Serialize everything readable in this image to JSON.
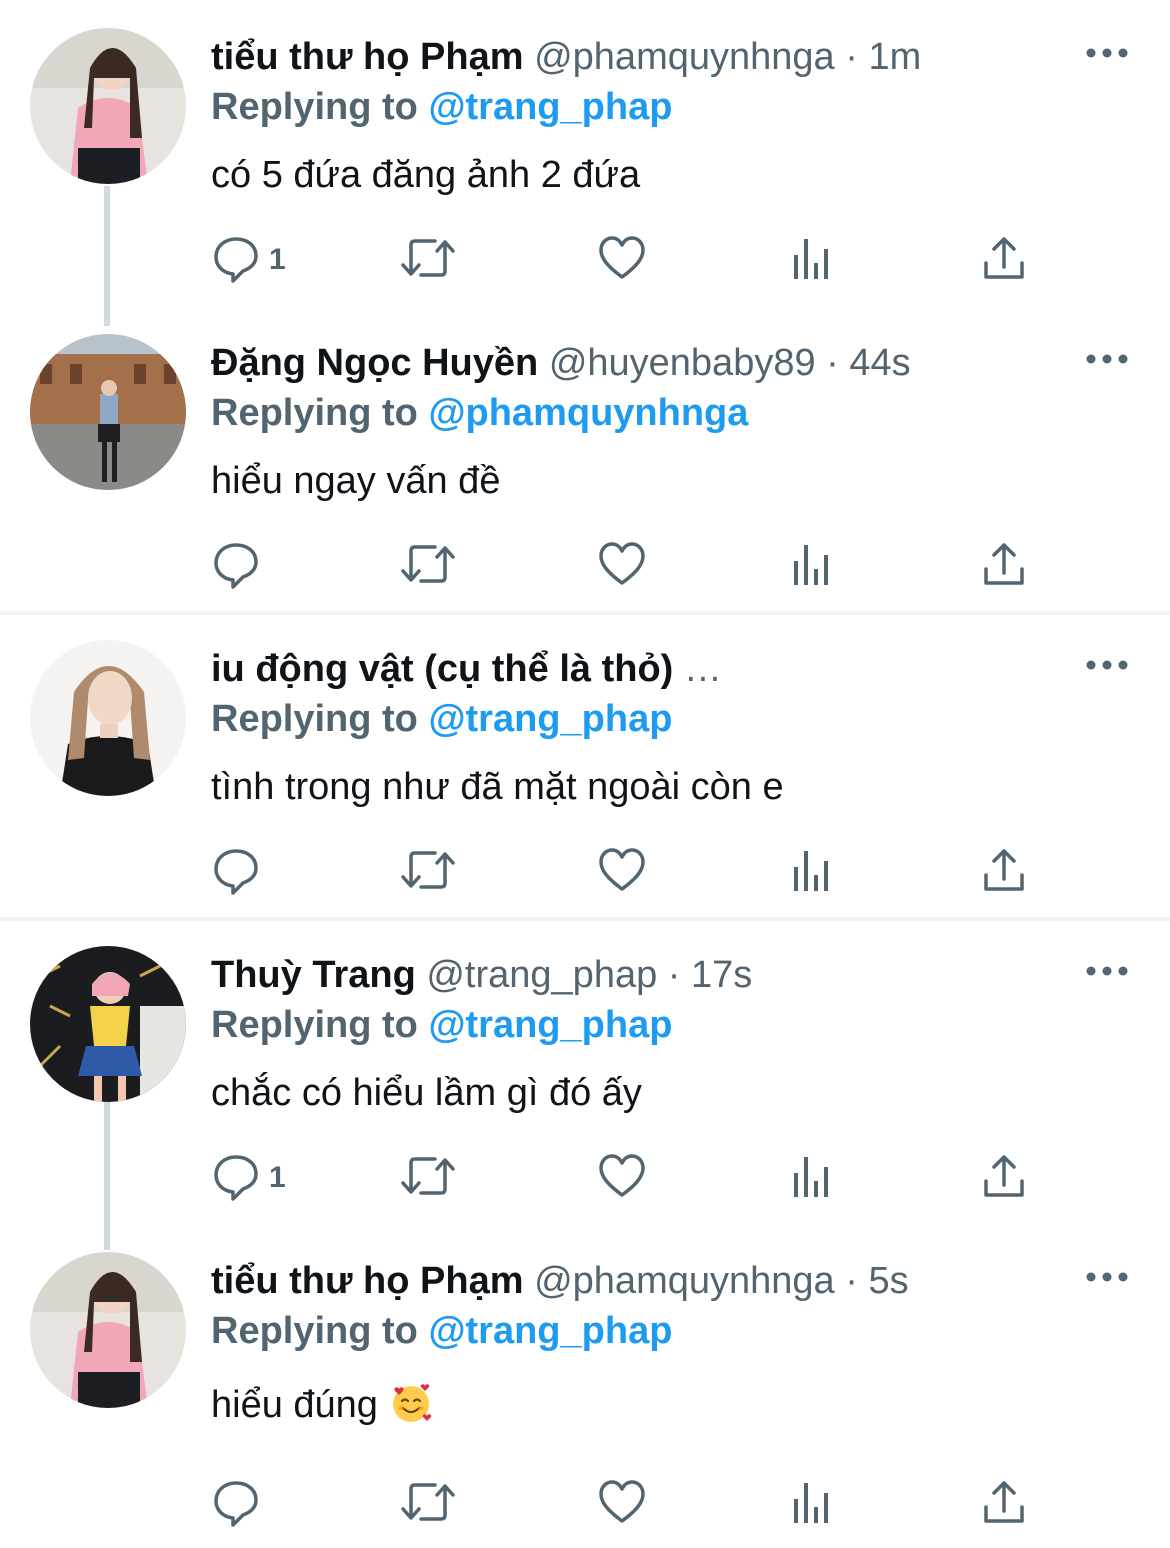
{
  "tweets": [
    {
      "name": "tiểu thư họ Phạm",
      "handle": "@phamquynhnga",
      "time": "1m",
      "replying_prefix": "Replying to",
      "replying_handle": "@trang_phap",
      "text": "có 5 đứa đăng ảnh 2 đứa",
      "reply_count": "1"
    },
    {
      "name": "Đặng Ngọc Huyền",
      "handle": "@huyenbaby89",
      "time": "44s",
      "replying_prefix": "Replying to",
      "replying_handle": "@phamquynhnga",
      "text": "hiểu ngay vấn đề",
      "reply_count": ""
    },
    {
      "name": "iu động vật (cụ thể là thỏ)",
      "handle": "…",
      "time": "",
      "replying_prefix": "Replying to",
      "replying_handle": "@trang_phap",
      "text": "tình trong như đã mặt ngoài còn e",
      "reply_count": ""
    },
    {
      "name": "Thuỳ Trang",
      "handle": "@trang_phap",
      "time": "17s",
      "replying_prefix": "Replying to",
      "replying_handle": "@trang_phap",
      "text": "chắc có hiểu lầm gì đó ấy",
      "reply_count": "1"
    },
    {
      "name": "tiểu thư họ Phạm",
      "handle": "@phamquynhnga",
      "time": "5s",
      "replying_prefix": "Replying to",
      "replying_handle": "@trang_phap",
      "text": "hiểu đúng",
      "text_emoji": "smiling-face-with-hearts-emoji",
      "reply_count": ""
    }
  ],
  "separator": "·",
  "icons": {
    "reply": "reply-icon",
    "retweet": "retweet-icon",
    "like": "like-icon",
    "analytics": "analytics-icon",
    "share": "share-icon",
    "more": "more-icon"
  },
  "colors": {
    "accent": "#1d9bf0",
    "text": "#0f1419",
    "secondary": "#536471",
    "divider": "#eff3f4",
    "thread_line": "#cfd9de"
  }
}
